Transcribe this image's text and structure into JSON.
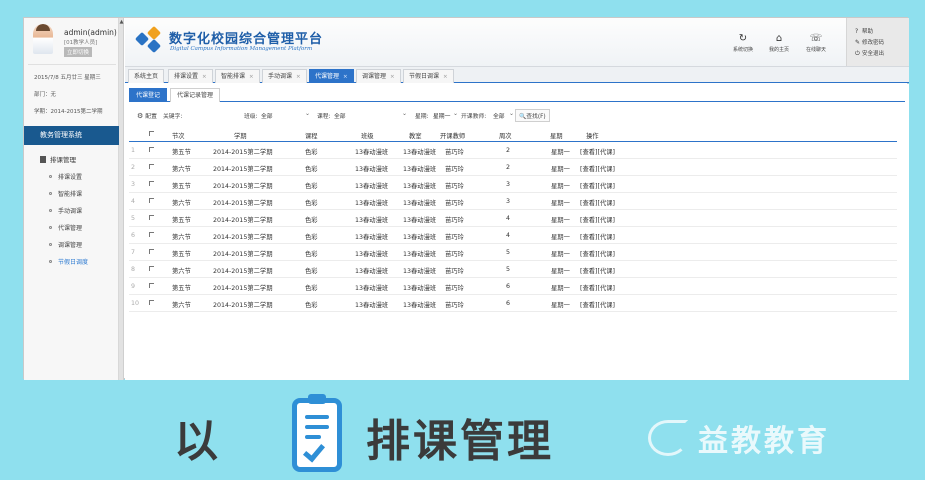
{
  "user": {
    "name": "admin(admin)",
    "role": "[01教学人员]",
    "switch_btn": "立即切换",
    "date_line": "2015/7/8 五月廿三 星期三",
    "dept_line": "部门：无",
    "term_line": "学期：2014-2015第二学期"
  },
  "sidebar": {
    "system_title": "教务管理系统",
    "main_item": "排课管理",
    "sub_items": [
      "排课设置",
      "智能排课",
      "手动调课",
      "代课管理",
      "调课管理",
      "节假日调度"
    ]
  },
  "header": {
    "brand_cn": "数字化校园综合管理平台",
    "brand_en": "Digital Campus Information Management Platform",
    "buttons": [
      {
        "label": "系统切换",
        "icon": "refresh-icon"
      },
      {
        "label": "我的主页",
        "icon": "home-icon"
      },
      {
        "label": "在线聊天",
        "icon": "chat-icon"
      }
    ],
    "right_links": [
      {
        "label": "帮助",
        "icon": "help-icon"
      },
      {
        "label": "修改密码",
        "icon": "edit-icon"
      },
      {
        "label": "安全退出",
        "icon": "power-icon"
      }
    ]
  },
  "tabs": [
    {
      "label": "系统主页",
      "closable": false,
      "active": false
    },
    {
      "label": "排课设置",
      "closable": true,
      "active": false
    },
    {
      "label": "智能排课",
      "closable": true,
      "active": false
    },
    {
      "label": "手动调课",
      "closable": true,
      "active": false
    },
    {
      "label": "代课管理",
      "closable": true,
      "active": true
    },
    {
      "label": "调课管理",
      "closable": true,
      "active": false
    },
    {
      "label": "节假日调课",
      "closable": true,
      "active": false
    }
  ],
  "subtabs": [
    {
      "label": "代课登记",
      "active": true
    },
    {
      "label": "代课记录管理",
      "active": false
    }
  ],
  "filters": {
    "config_label": "配置",
    "keyword_label": "关键字:",
    "class_label": "班级:",
    "class_value": "全部",
    "course_label": "课程:",
    "course_value": "全部",
    "weekday_label": "星期:",
    "weekday_value": "星期一",
    "teacher_label": "开课教师:",
    "teacher_value": "全部",
    "search_label": "查找(F)"
  },
  "table": {
    "headers": [
      "节次",
      "学期",
      "课程",
      "班级",
      "教室",
      "开课教师",
      "周次",
      "星期",
      "操作"
    ],
    "rows": [
      {
        "no": "1",
        "section": "第五节",
        "term": "2014-2015第二学期",
        "course": "色彩",
        "class": "13春动漫班",
        "room": "13春动漫班",
        "teacher": "苗巧玲",
        "week": "2",
        "day": "星期一",
        "ops": "[查看][代课]"
      },
      {
        "no": "2",
        "section": "第六节",
        "term": "2014-2015第二学期",
        "course": "色彩",
        "class": "13春动漫班",
        "room": "13春动漫班",
        "teacher": "苗巧玲",
        "week": "2",
        "day": "星期一",
        "ops": "[查看][代课]"
      },
      {
        "no": "3",
        "section": "第五节",
        "term": "2014-2015第二学期",
        "course": "色彩",
        "class": "13春动漫班",
        "room": "13春动漫班",
        "teacher": "苗巧玲",
        "week": "3",
        "day": "星期一",
        "ops": "[查看][代课]"
      },
      {
        "no": "4",
        "section": "第六节",
        "term": "2014-2015第二学期",
        "course": "色彩",
        "class": "13春动漫班",
        "room": "13春动漫班",
        "teacher": "苗巧玲",
        "week": "3",
        "day": "星期一",
        "ops": "[查看][代课]"
      },
      {
        "no": "5",
        "section": "第五节",
        "term": "2014-2015第二学期",
        "course": "色彩",
        "class": "13春动漫班",
        "room": "13春动漫班",
        "teacher": "苗巧玲",
        "week": "4",
        "day": "星期一",
        "ops": "[查看][代课]"
      },
      {
        "no": "6",
        "section": "第六节",
        "term": "2014-2015第二学期",
        "course": "色彩",
        "class": "13春动漫班",
        "room": "13春动漫班",
        "teacher": "苗巧玲",
        "week": "4",
        "day": "星期一",
        "ops": "[查看][代课]"
      },
      {
        "no": "7",
        "section": "第五节",
        "term": "2014-2015第二学期",
        "course": "色彩",
        "class": "13春动漫班",
        "room": "13春动漫班",
        "teacher": "苗巧玲",
        "week": "5",
        "day": "星期一",
        "ops": "[查看][代课]"
      },
      {
        "no": "8",
        "section": "第六节",
        "term": "2014-2015第二学期",
        "course": "色彩",
        "class": "13春动漫班",
        "room": "13春动漫班",
        "teacher": "苗巧玲",
        "week": "5",
        "day": "星期一",
        "ops": "[查看][代课]"
      },
      {
        "no": "9",
        "section": "第五节",
        "term": "2014-2015第二学期",
        "course": "色彩",
        "class": "13春动漫班",
        "room": "13春动漫班",
        "teacher": "苗巧玲",
        "week": "6",
        "day": "星期一",
        "ops": "[查看][代课]"
      },
      {
        "no": "10",
        "section": "第六节",
        "term": "2014-2015第二学期",
        "course": "色彩",
        "class": "13春动漫班",
        "room": "13春动漫班",
        "teacher": "苗巧玲",
        "week": "6",
        "day": "星期一",
        "ops": "[查看][代课]"
      }
    ]
  },
  "caption": {
    "prefix": "以",
    "icon": "clipboard-check-icon",
    "title": "排课管理",
    "watermark": "益教教育"
  },
  "colors": {
    "background": "#8fe0ee",
    "accent": "#2d73c9",
    "sidebar_title": "#19598f",
    "brand": "#1f5ea8"
  }
}
